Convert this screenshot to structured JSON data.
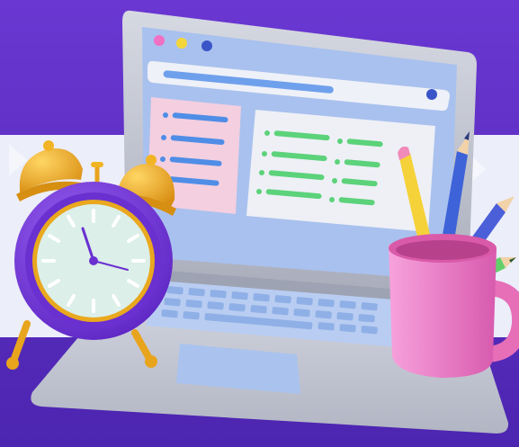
{
  "scene": {
    "description_alt": "3D illustration",
    "colors": {
      "background_top": "#6434cf",
      "background_bottom": "#4e27b4",
      "band": "#eef0fb",
      "laptop_body": "#c9ccd6",
      "screen_frame": "#b8bfd0",
      "screen_bg": "#aac2ee",
      "card_left": "#f2cfe0",
      "card_right": "#eef0f6",
      "line_blue": "#4f8de6",
      "line_green": "#5cd27a",
      "keys": "#a9c3ee",
      "clock_body": "#7a3fe0",
      "clock_face": "#dbeee8",
      "bell": "#f2b425",
      "mug": "#ef7cc6",
      "pencil_yellow": "#f6d23a",
      "pencil_blue": "#3e63d8",
      "pencil_green": "#62d06a"
    },
    "icons": {
      "laptop": "laptop-icon",
      "clock": "alarm-clock-icon",
      "mug": "pencil-mug-icon"
    }
  }
}
